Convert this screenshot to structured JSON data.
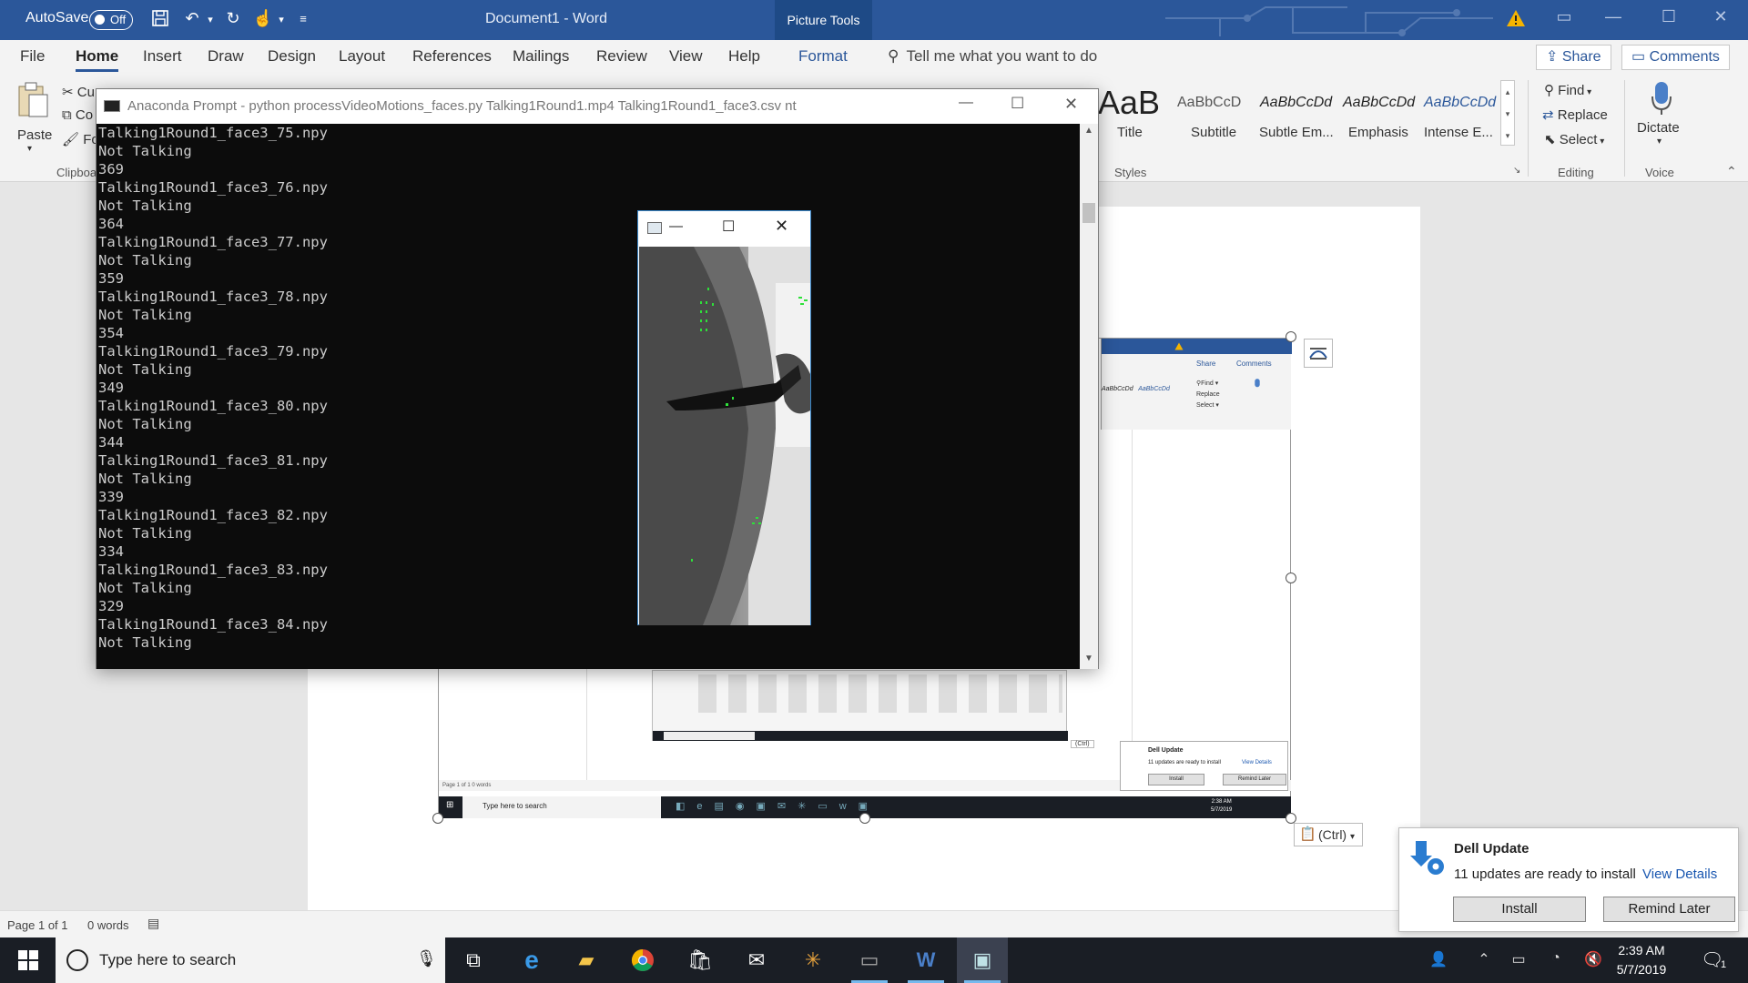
{
  "word": {
    "autosave_label": "AutoSave",
    "autosave_state": "Off",
    "doc_title": "Document1 - Word",
    "context_tab": "Picture Tools",
    "tabs": [
      "File",
      "Home",
      "Insert",
      "Draw",
      "Design",
      "Layout",
      "References",
      "Mailings",
      "Review",
      "View",
      "Help",
      "Format"
    ],
    "active_tab": "Home",
    "tell_me": "Tell me what you want to do",
    "share": "Share",
    "comments": "Comments"
  },
  "ribbon": {
    "paste": "Paste",
    "cut": "Cu",
    "copy": "Co",
    "format_painter": "Fo",
    "clipboard_label": "Clipboa",
    "styles": [
      {
        "preview": "AaB",
        "name": "Title"
      },
      {
        "preview": "AaBbCcD",
        "name": "Subtitle"
      },
      {
        "preview": "AaBbCcDd",
        "name": "Subtle Em..."
      },
      {
        "preview": "AaBbCcDd",
        "name": "Emphasis"
      },
      {
        "preview": "AaBbCcDd",
        "name": "Intense E..."
      }
    ],
    "styles_label": "Styles",
    "find": "Find",
    "replace": "Replace",
    "select": "Select",
    "editing_label": "Editing",
    "dictate": "Dictate",
    "voice_label": "Voice"
  },
  "console": {
    "title": "Anaconda Prompt - python  processVideoMotions_faces.py Talking1Round1.mp4 Talking1Round1_face3.csv nt",
    "lines": [
      "Talking1Round1_face3_75.npy",
      "Not Talking",
      "369",
      "Talking1Round1_face3_76.npy",
      "Not Talking",
      "364",
      "Talking1Round1_face3_77.npy",
      "Not Talking",
      "359",
      "Talking1Round1_face3_78.npy",
      "Not Talking",
      "354",
      "Talking1Round1_face3_79.npy",
      "Not Talking",
      "349",
      "Talking1Round1_face3_80.npy",
      "Not Talking",
      "344",
      "Talking1Round1_face3_81.npy",
      "Not Talking",
      "339",
      "Talking1Round1_face3_82.npy",
      "Not Talking",
      "334",
      "Talking1Round1_face3_83.npy",
      "Not Talking",
      "329",
      "Talking1Round1_face3_84.npy",
      "Not Talking"
    ]
  },
  "pasted_screenshot": {
    "share": "Share",
    "comments": "Comments",
    "search": "Type here to search",
    "status": "Page 1 of 1     0 words",
    "clock_time": "2:38 AM",
    "clock_date": "5/7/2019",
    "toast_title": "Dell Update",
    "toast_msg": "11 updates are ready to install",
    "toast_link": "View Details",
    "toast_install": "Install",
    "toast_remind": "Remind Later",
    "ctrl": "(Ctrl)"
  },
  "ctrl_paste": "(Ctrl)",
  "status": {
    "page": "Page 1 of 1",
    "words": "0 words"
  },
  "toast": {
    "title": "Dell Update",
    "message": "11 updates are ready to install",
    "link": "View Details",
    "install": "Install",
    "remind": "Remind Later"
  },
  "taskbar": {
    "search_placeholder": "Type here to search",
    "time": "2:39 AM",
    "date": "5/7/2019",
    "notification_count": "1"
  },
  "colors": {
    "word_blue": "#2b579a",
    "console_bg": "#0c0c0c",
    "taskbar": "#1a1e25",
    "link": "#1a57b0"
  }
}
